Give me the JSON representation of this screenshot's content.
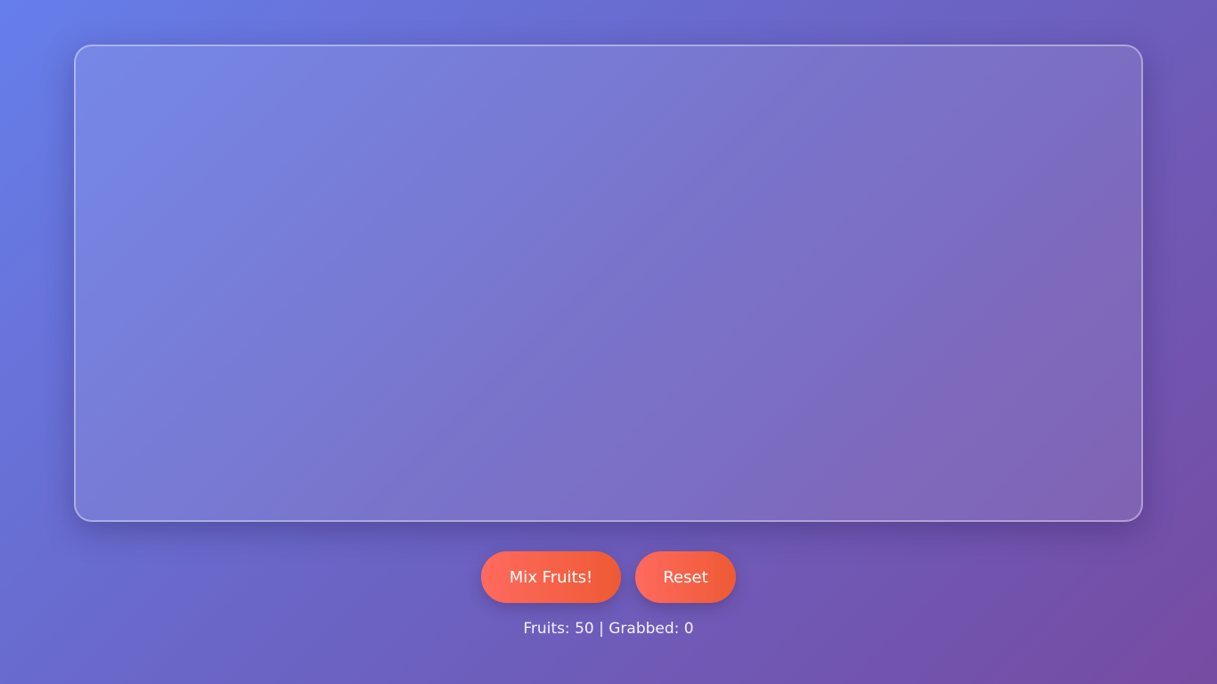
{
  "controls": {
    "mix_label": "Mix Fruits!",
    "reset_label": "Reset"
  },
  "stats": {
    "fruits_label": "Fruits:",
    "fruits_count": "50",
    "separator": "|",
    "grabbed_label": "Grabbed:",
    "grabbed_count": "0"
  },
  "colors": {
    "background_start": "#667eea",
    "background_end": "#764ba2",
    "button_start": "#ff6a5e",
    "button_end": "#ee5a34"
  }
}
